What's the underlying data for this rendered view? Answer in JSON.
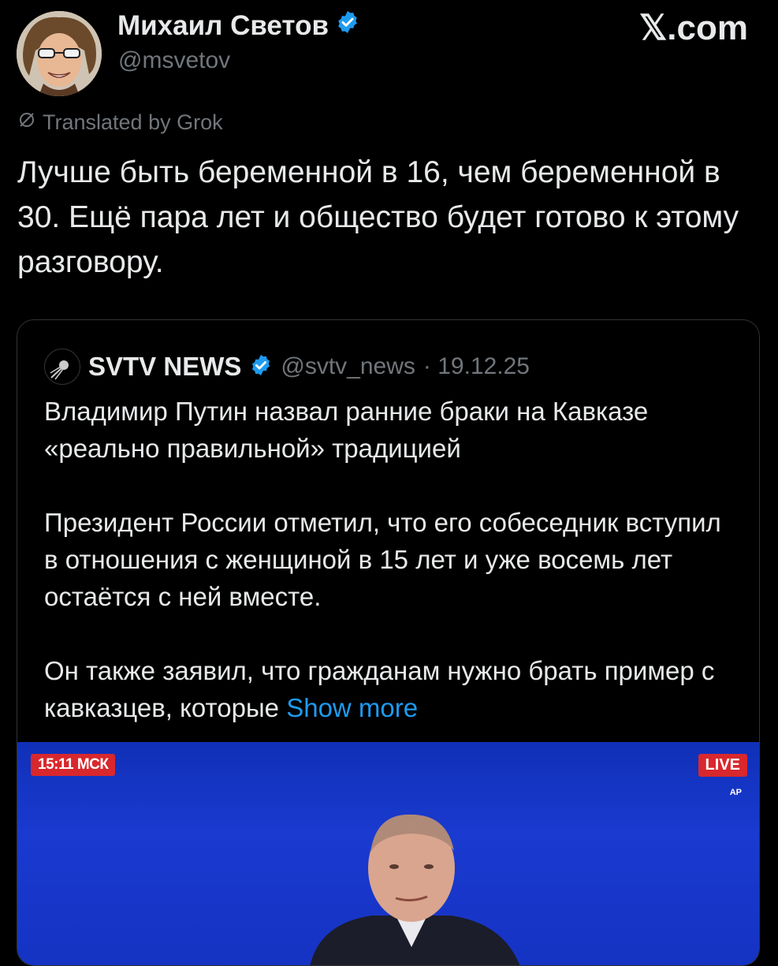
{
  "author": {
    "name": "Михаил Светов",
    "handle": "@msvetov",
    "verified": true
  },
  "site_label": "𝕏.com",
  "translation": {
    "label": "Translated by Grok"
  },
  "tweet": {
    "text": "Лучше быть беременной в 16, чем беременной в 30. Ещё пара лет и общество будет готово к этому разговору."
  },
  "quote": {
    "name": "SVTV NEWS",
    "handle": "@svtv_news",
    "date": "· 19.12.25",
    "paragraphs": [
      "Владимир Путин назвал ранние браки на Кавказе «реально правильной» традицией",
      "Президент России отметил, что его собеседник вступил в отношения с женщиной в 15 лет и уже восемь лет остаётся с ней вместе.",
      "Он также заявил, что гражданам нужно брать пример с кавказцев, которые"
    ],
    "show_more": "Show more"
  },
  "media": {
    "time_badge": "15:11 МСК",
    "live_badge": "LIVE",
    "agency": "AP"
  },
  "colors": {
    "background": "#000000",
    "text": "#e7e9ea",
    "muted": "#71767b",
    "link": "#1d9bf0",
    "verified": "#1d9bf0",
    "badge_red": "#d8282d",
    "media_blue": "#1a3ad0"
  }
}
